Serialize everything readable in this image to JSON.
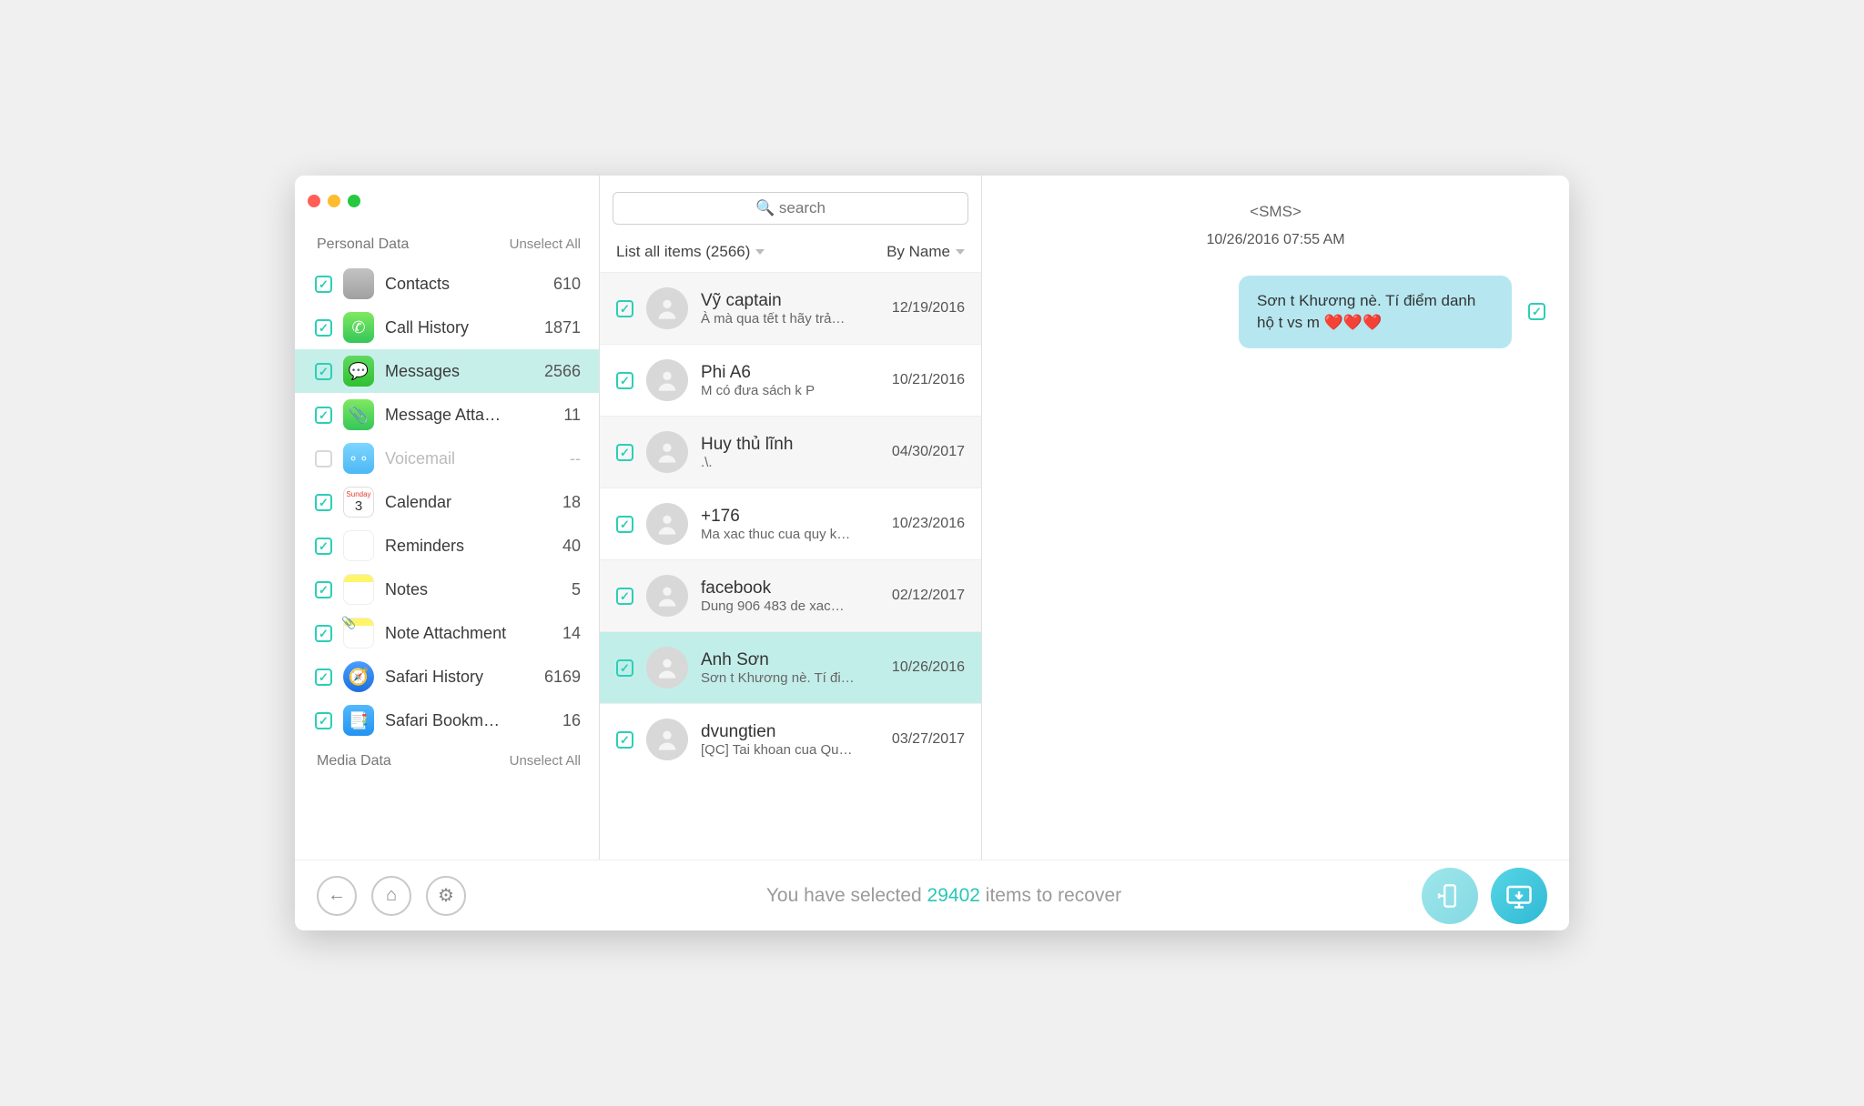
{
  "search_placeholder": "🔍 search",
  "sidebar": {
    "section1_label": "Personal Data",
    "section1_action": "Unselect All",
    "section2_label": "Media Data",
    "section2_action": "Unselect All",
    "items": [
      {
        "label": "Contacts",
        "count": "610"
      },
      {
        "label": "Call History",
        "count": "1871"
      },
      {
        "label": "Messages",
        "count": "2566"
      },
      {
        "label": "Message Atta…",
        "count": "11"
      },
      {
        "label": "Voicemail",
        "count": "--"
      },
      {
        "label": "Calendar",
        "count": "18"
      },
      {
        "label": "Reminders",
        "count": "40"
      },
      {
        "label": "Notes",
        "count": "5"
      },
      {
        "label": "Note Attachment",
        "count": "14"
      },
      {
        "label": "Safari History",
        "count": "6169"
      },
      {
        "label": "Safari Bookm…",
        "count": "16"
      }
    ]
  },
  "list_head": {
    "filter": "List all items (2566)",
    "sort": "By Name"
  },
  "conversations": [
    {
      "name": "Vỹ captain",
      "preview": "À mà qua tết t hãy trả…",
      "date": "12/19/2016"
    },
    {
      "name": "Phi A6",
      "preview": "M có đưa sách k P",
      "date": "10/21/2016"
    },
    {
      "name": "Huy thủ lĩnh",
      "preview": ".\\.",
      "date": "04/30/2017"
    },
    {
      "name": "+176",
      "preview": "Ma xac thuc cua quy k…",
      "date": "10/23/2016"
    },
    {
      "name": "facebook",
      "preview": "Dung 906 483 de xac…",
      "date": "02/12/2017"
    },
    {
      "name": "Anh Sơn",
      "preview": "Sơn t Khương nè. Tí đi…",
      "date": "10/26/2016"
    },
    {
      "name": "dvungtien",
      "preview": "[QC] Tai khoan cua Qu…",
      "date": "03/27/2017"
    }
  ],
  "detail": {
    "head": "<SMS>",
    "time": "10/26/2016 07:55 AM",
    "bubble": "Sơn t Khương nè. Tí điểm danh hộ t vs m ❤️❤️❤️"
  },
  "footer": {
    "prefix": "You have selected ",
    "count": "29402",
    "suffix": " items to recover"
  }
}
